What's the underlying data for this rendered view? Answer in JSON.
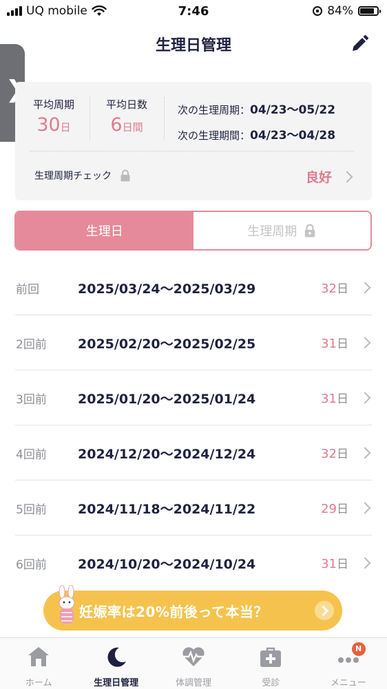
{
  "status_bar": {
    "carrier": "UQ mobile",
    "time": "7:46",
    "battery": "84%",
    "battery_level": 0.84
  },
  "header": {
    "title": "生理日管理",
    "edit_icon": "pencil-icon"
  },
  "drawer": {
    "icon": "chevron-right-icon",
    "glyph": "❯"
  },
  "summary": {
    "avg_cycle": {
      "label": "平均周期",
      "value": "30",
      "unit": "日"
    },
    "avg_days": {
      "label": "平均日数",
      "value": "6",
      "unit": "日間"
    },
    "next_cycle": {
      "label": "次の生理周期：",
      "value": "04/23〜05/22"
    },
    "next_period": {
      "label": "次の生理期間：",
      "value": "04/23〜04/28"
    },
    "check": {
      "label": "生理周期チェック",
      "status": "良好"
    }
  },
  "tabs": [
    {
      "label": "生理日",
      "active": true
    },
    {
      "label": "生理周期",
      "active": false,
      "locked": true
    }
  ],
  "history": [
    {
      "label": "前回",
      "range": "2025/03/24〜2025/03/29",
      "days": "32",
      "unit": "日"
    },
    {
      "label": "2回前",
      "range": "2025/02/20〜2025/02/25",
      "days": "31",
      "unit": "日"
    },
    {
      "label": "3回前",
      "range": "2025/01/20〜2025/01/24",
      "days": "31",
      "unit": "日"
    },
    {
      "label": "4回前",
      "range": "2024/12/20〜2024/12/24",
      "days": "32",
      "unit": "日"
    },
    {
      "label": "5回前",
      "range": "2024/11/18〜2024/11/22",
      "days": "29",
      "unit": "日"
    },
    {
      "label": "6回前",
      "range": "2024/10/20〜2024/10/24",
      "days": "31",
      "unit": "日"
    }
  ],
  "banner": {
    "text": "妊娠率は20%前後って本当？"
  },
  "nav": [
    {
      "label": "ホーム",
      "icon": "home-icon"
    },
    {
      "label": "生理日管理",
      "icon": "moon-icon",
      "active": true
    },
    {
      "label": "体調管理",
      "icon": "heart-pulse-icon"
    },
    {
      "label": "受診",
      "icon": "medical-bag-icon"
    },
    {
      "label": "メニュー",
      "icon": "more-icon",
      "badge": "N"
    }
  ],
  "colors": {
    "accent": "#e58a9a",
    "accent_text": "#e07b8e",
    "banner": "#f5c34d",
    "text": "#1f2140",
    "badge": "#e8603c"
  }
}
